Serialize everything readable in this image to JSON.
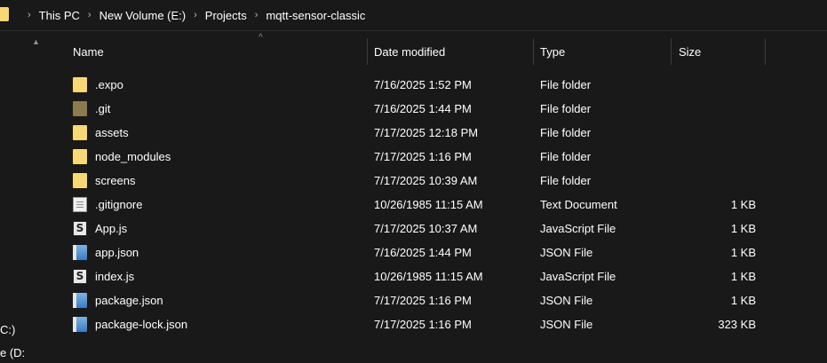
{
  "breadcrumb": [
    "This PC",
    "New Volume (E:)",
    "Projects",
    "mqtt-sensor-classic"
  ],
  "nav": {
    "items": [
      "C:)",
      "e (D:"
    ]
  },
  "columns": {
    "name": "Name",
    "date": "Date modified",
    "type": "Type",
    "size": "Size"
  },
  "files": [
    {
      "name": ".expo",
      "date": "7/16/2025 1:52 PM",
      "type": "File folder",
      "size": "",
      "icon": "folder-icon"
    },
    {
      "name": ".git",
      "date": "7/16/2025 1:44 PM",
      "type": "File folder",
      "size": "",
      "icon": "folder-icon"
    },
    {
      "name": "assets",
      "date": "7/17/2025 12:18 PM",
      "type": "File folder",
      "size": "",
      "icon": "folder-icon"
    },
    {
      "name": "node_modules",
      "date": "7/17/2025 1:16 PM",
      "type": "File folder",
      "size": "",
      "icon": "folder-icon"
    },
    {
      "name": "screens",
      "date": "7/17/2025 10:39 AM",
      "type": "File folder",
      "size": "",
      "icon": "folder-icon"
    },
    {
      "name": ".gitignore",
      "date": "10/26/1985 11:15 AM",
      "type": "Text Document",
      "size": "1 KB",
      "icon": "text-file-icon"
    },
    {
      "name": "App.js",
      "date": "7/17/2025 10:37 AM",
      "type": "JavaScript File",
      "size": "1 KB",
      "icon": "javascript-file-icon"
    },
    {
      "name": "app.json",
      "date": "7/16/2025 1:44 PM",
      "type": "JSON File",
      "size": "1 KB",
      "icon": "json-file-icon"
    },
    {
      "name": "index.js",
      "date": "10/26/1985 11:15 AM",
      "type": "JavaScript File",
      "size": "1 KB",
      "icon": "javascript-file-icon"
    },
    {
      "name": "package.json",
      "date": "7/17/2025 1:16 PM",
      "type": "JSON File",
      "size": "1 KB",
      "icon": "json-file-icon"
    },
    {
      "name": "package-lock.json",
      "date": "7/17/2025 1:16 PM",
      "type": "JSON File",
      "size": "323 KB",
      "icon": "json-file-icon"
    }
  ],
  "colors": {
    "background": "#191919",
    "folder": "#f8d775",
    "text": "#ffffff"
  }
}
